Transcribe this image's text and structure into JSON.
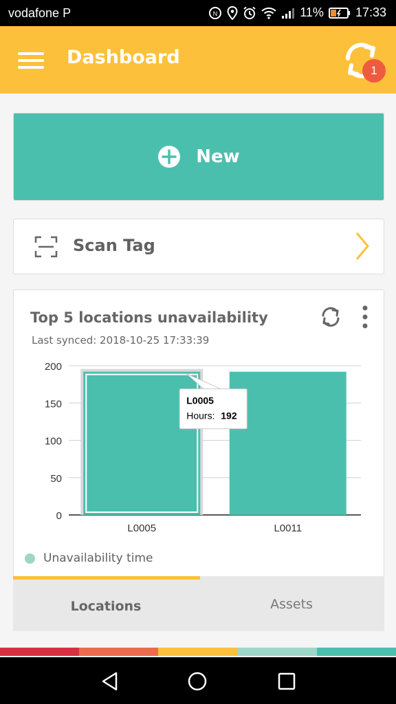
{
  "status_bar": {
    "carrier": "vodafone P",
    "battery_percent": "11%",
    "time": "17:33"
  },
  "app_bar": {
    "title": "Dashboard",
    "sync_badge_count": "1",
    "menu_icon": "hamburger-menu-icon",
    "sync_icon": "sync-icon"
  },
  "new_button": {
    "label": "New",
    "icon": "plus-circle-icon"
  },
  "scan_tag": {
    "label": "Scan Tag",
    "icon": "scan-frame-icon",
    "chevron_icon": "chevron-right-icon"
  },
  "chart_card": {
    "title": "Top 5 locations unavailability",
    "last_synced": "Last synced: 2018-10-25 17:33:39",
    "tooltip": {
      "category": "L0005",
      "label": "Hours:",
      "value": "192"
    },
    "legend_label": "Unavailability time"
  },
  "chart_data": {
    "type": "bar",
    "categories": [
      "L0005",
      "L0011"
    ],
    "series": [
      {
        "name": "Unavailability time",
        "values": [
          192,
          192
        ],
        "color": "#4bbfad"
      }
    ],
    "ylim": [
      0,
      200
    ],
    "yticks": [
      0,
      50,
      100,
      150,
      200
    ],
    "grid": true,
    "selected_category": "L0005",
    "legend_position": "bottom-left"
  },
  "tabs": {
    "items": [
      {
        "label": "Locations",
        "active": true
      },
      {
        "label": "Assets",
        "active": false
      }
    ]
  },
  "colors": {
    "accent": "#fcc03a",
    "primary": "#4bbfad",
    "badge": "#ef5b3f",
    "stripe": [
      "#d9303f",
      "#ec6b4c",
      "#fcc03a",
      "#9ed6c9",
      "#4bbfad"
    ]
  }
}
